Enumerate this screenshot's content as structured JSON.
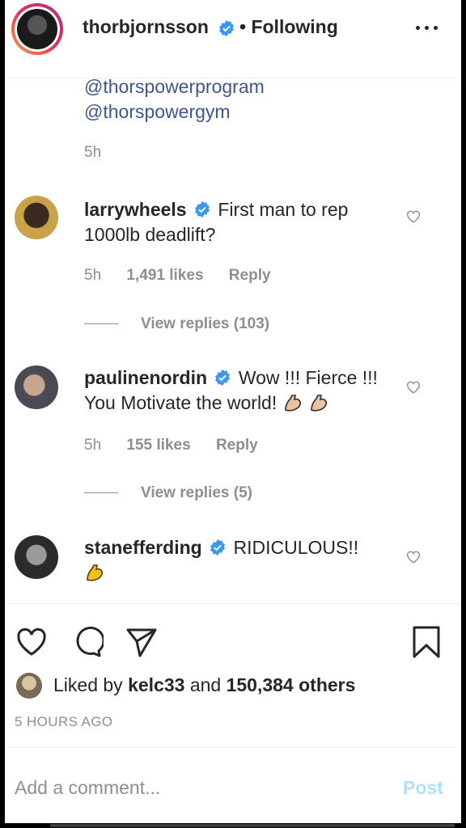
{
  "header": {
    "username": "thorbjornsson",
    "separator": "•",
    "follow_status": "Following",
    "more_icon": "more-options-icon"
  },
  "caption": {
    "mentions": [
      "@thorspowerprogram",
      "@thorspowergym"
    ],
    "time": "5h"
  },
  "comments": [
    {
      "username": "larrywheels",
      "text": "First man to rep 1000lb deadlift?",
      "time": "5h",
      "likes": "1,491 likes",
      "reply": "Reply",
      "view_replies": "View replies (103)"
    },
    {
      "username": "paulinenordin",
      "text": "Wow !!! Fierce !!! You Motivate the world!",
      "emoji": "flexed-biceps x2",
      "time": "5h",
      "likes": "155 likes",
      "reply": "Reply",
      "view_replies": "View replies (5)"
    },
    {
      "username": "stanefferding",
      "text": "RIDICULOUS!!",
      "emoji": "flexed-biceps"
    }
  ],
  "likes": {
    "prefix": "Liked by",
    "user": "kelc33",
    "middle": "and",
    "count": "150,384 others"
  },
  "timestamp": "5 HOURS AGO",
  "add_comment": {
    "placeholder": "Add a comment...",
    "post_label": "Post"
  },
  "colors": {
    "verified": "#3897f0",
    "post_disabled": "#b2dffc",
    "muted": "#8e8e8e"
  }
}
